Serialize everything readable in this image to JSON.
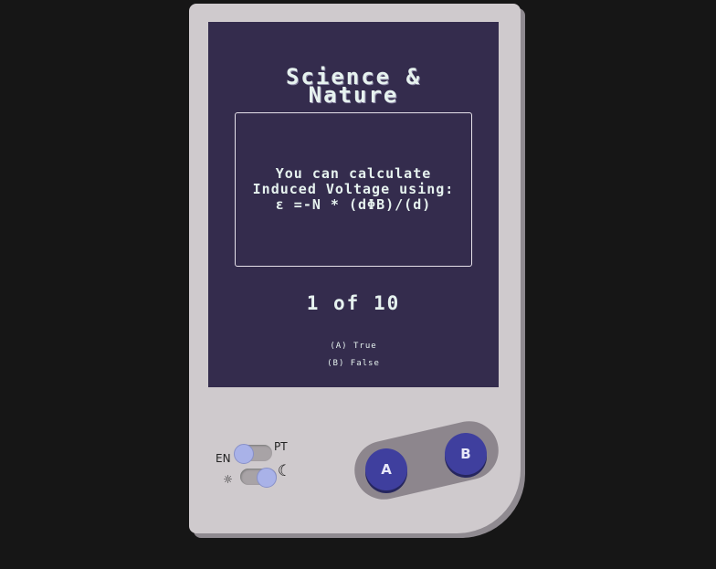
{
  "screen": {
    "title_line1": "Science &",
    "title_line2": "Nature",
    "question": "You can calculate Induced Voltage using: ε =-N * (dΦB)/(d)",
    "counter": "1 of 10",
    "answer_a": "(A) True",
    "answer_b": "(B) False"
  },
  "controls": {
    "lang_left": "EN",
    "lang_right": "PT",
    "button_a": "A",
    "button_b": "B",
    "sun_icon": "☼",
    "moon_icon": "☾"
  },
  "colors": {
    "screen_bg": "#342c4d",
    "console_body": "#cfcacd",
    "button": "#3f3f9e",
    "toggle_knob": "#a9b2e8"
  }
}
